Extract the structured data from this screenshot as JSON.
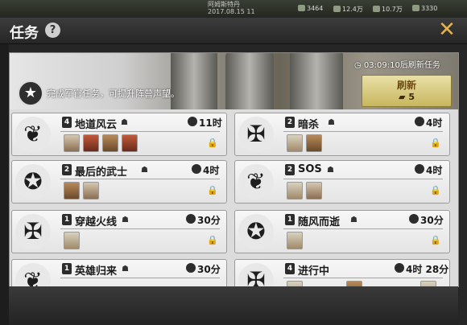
{
  "topbar": {
    "name": "阿姆斯特丹",
    "date": "2017.08.15 11",
    "res1": "3464",
    "res2": "12.4万",
    "res3": "10.7万",
    "res4": "3330"
  },
  "header": {
    "title": "任务",
    "help": "?",
    "close": "✕"
  },
  "banner": {
    "description": "完成军官任务，可提升阵营声望。",
    "refresh_timer": "03:09:10后刷新任务",
    "refresh_label": "刷新",
    "refresh_cost": "5",
    "star_icon": "★"
  },
  "tasks": [
    {
      "level": "4",
      "name": "地道风云",
      "time": "11时",
      "emblem": "eagle-shield-icon"
    },
    {
      "level": "2",
      "name": "暗杀",
      "time": "4时",
      "emblem": "winged-sword-icon"
    },
    {
      "level": "2",
      "name": "最后的武士",
      "time": "4时",
      "emblem": "gear-blade-icon"
    },
    {
      "level": "2",
      "name": "SOS",
      "time": "4时",
      "emblem": "eagle-shield-icon"
    },
    {
      "level": "1",
      "name": "穿越火线",
      "time": "30分",
      "emblem": "winged-sword-icon"
    },
    {
      "level": "1",
      "name": "随风而逝",
      "time": "30分",
      "emblem": "gear-blade-icon"
    },
    {
      "level": "1",
      "name": "英雄归来",
      "time": "30分",
      "emblem": "eagle-shield-icon"
    },
    {
      "level": "4",
      "name": "进行中",
      "time": "4时 28分",
      "emblem": "winged-sword-icon"
    }
  ],
  "icons": {
    "lock": "🔒",
    "hat": "☗",
    "eagle": "❦",
    "sword": "✠",
    "gear": "✪"
  }
}
